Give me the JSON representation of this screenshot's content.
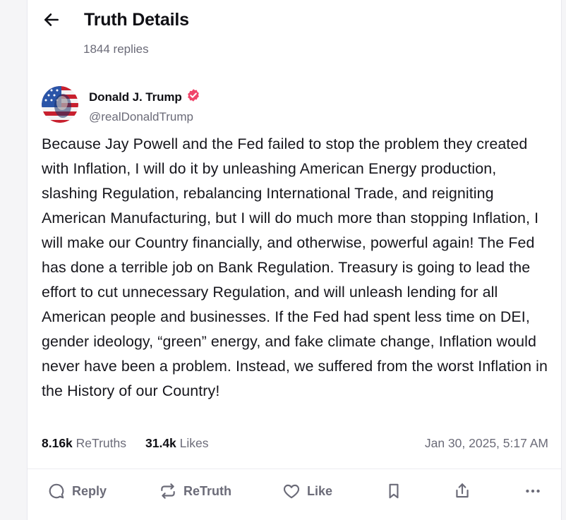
{
  "header": {
    "back_icon": "arrow-left-icon",
    "title": "Truth Details",
    "replies": "1844 replies"
  },
  "post": {
    "author": {
      "name": "Donald J. Trump",
      "verified_icon": "verified-badge-icon",
      "verified_color": "#f0456a",
      "handle": "@realDonaldTrump"
    },
    "text": "Because Jay Powell and the Fed failed to stop the problem they created with Inflation, I will do it by unleashing American Energy production, slashing Regulation, rebalancing International Trade, and reigniting American Manufacturing, but I will do much more than stopping Inflation, I will make our Country financially, and otherwise, powerful again! The Fed has done a terrible job on Bank Regulation. Treasury is going to lead the effort to cut unnecessary Regulation, and will unleash lending for all American people and businesses. If the Fed had spent less time on DEI, gender ideology, “green” energy, and fake climate change, Inflation would never have been a problem. Instead, we suffered from the worst Inflation in the History of our Country!",
    "stats": {
      "retruths_count": "8.16k",
      "retruths_label": "ReTruths",
      "likes_count": "31.4k",
      "likes_label": "Likes",
      "timestamp": "Jan 30, 2025, 5:17 AM"
    }
  },
  "actions": {
    "reply_label": "Reply",
    "retruth_label": "ReTruth",
    "like_label": "Like",
    "icons": [
      "reply-icon",
      "retruth-icon",
      "heart-icon",
      "bookmark-icon",
      "share-icon",
      "more-icon"
    ]
  },
  "colors": {
    "muted_text": "#6b6b78",
    "accent": "#f0456a"
  }
}
